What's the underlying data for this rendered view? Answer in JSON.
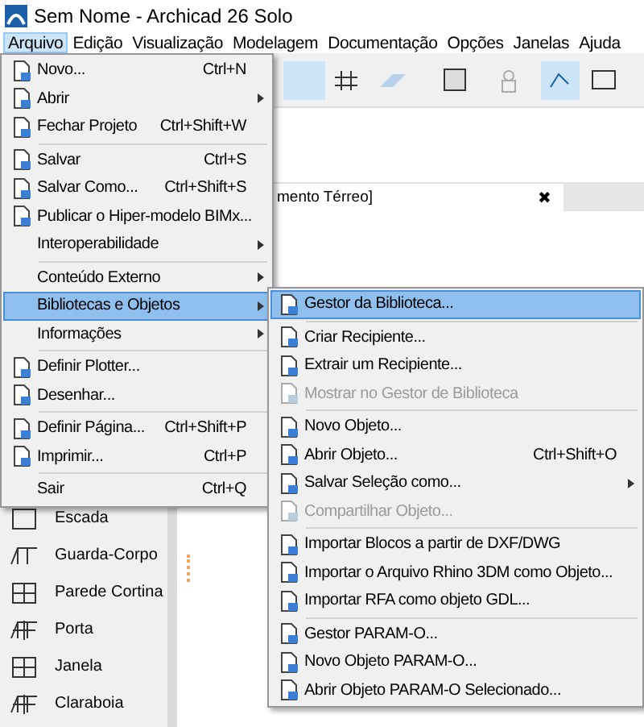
{
  "window": {
    "title": "Sem Nome - Archicad 26 Solo"
  },
  "menubar": [
    {
      "label": "Arquivo",
      "selected": true
    },
    {
      "label": "Edição",
      "selected": false
    },
    {
      "label": "Visualização",
      "selected": false
    },
    {
      "label": "Modelagem",
      "selected": false
    },
    {
      "label": "Documentação",
      "selected": false
    },
    {
      "label": "Opções",
      "selected": false
    },
    {
      "label": "Janelas",
      "selected": false
    },
    {
      "label": "Ajuda",
      "selected": false
    }
  ],
  "menu": {
    "items": [
      {
        "kind": "item",
        "label": "Novo...",
        "shortcut": "Ctrl+N",
        "icon": true,
        "submenu": false,
        "selected": false,
        "disabled": false
      },
      {
        "kind": "item",
        "label": "Abrir",
        "icon": true,
        "submenu": true,
        "selected": false,
        "disabled": false
      },
      {
        "kind": "item",
        "label": "Fechar Projeto",
        "shortcut": "Ctrl+Shift+W",
        "icon": true,
        "submenu": false,
        "selected": false,
        "disabled": false
      },
      {
        "kind": "separator"
      },
      {
        "kind": "item",
        "label": "Salvar",
        "shortcut": "Ctrl+S",
        "icon": true,
        "submenu": false,
        "selected": false,
        "disabled": false
      },
      {
        "kind": "item",
        "label": "Salvar Como...",
        "shortcut": "Ctrl+Shift+S",
        "icon": true,
        "submenu": false,
        "selected": false,
        "disabled": false
      },
      {
        "kind": "item",
        "label": "Publicar o Hiper-modelo BIMx...",
        "icon": true,
        "submenu": false,
        "selected": false,
        "disabled": false
      },
      {
        "kind": "item",
        "label": "Interoperabilidade",
        "icon": false,
        "submenu": true,
        "selected": false,
        "disabled": false
      },
      {
        "kind": "separator"
      },
      {
        "kind": "item",
        "label": "Conteúdo Externo",
        "icon": false,
        "submenu": true,
        "selected": false,
        "disabled": false
      },
      {
        "kind": "item",
        "label": "Bibliotecas e Objetos",
        "icon": false,
        "submenu": true,
        "selected": true,
        "disabled": false
      },
      {
        "kind": "item",
        "label": "Informações",
        "icon": false,
        "submenu": true,
        "selected": false,
        "disabled": false
      },
      {
        "kind": "separator"
      },
      {
        "kind": "item",
        "label": "Definir Plotter...",
        "icon": true,
        "submenu": false,
        "selected": false,
        "disabled": false
      },
      {
        "kind": "item",
        "label": "Desenhar...",
        "icon": true,
        "submenu": false,
        "selected": false,
        "disabled": false
      },
      {
        "kind": "separator"
      },
      {
        "kind": "item",
        "label": "Definir Página...",
        "shortcut": "Ctrl+Shift+P",
        "icon": true,
        "submenu": false,
        "selected": false,
        "disabled": false
      },
      {
        "kind": "item",
        "label": "Imprimir...",
        "shortcut": "Ctrl+P",
        "icon": true,
        "submenu": false,
        "selected": false,
        "disabled": false
      },
      {
        "kind": "separator"
      },
      {
        "kind": "item",
        "label": "Sair",
        "shortcut": "Ctrl+Q",
        "icon": false,
        "submenu": false,
        "selected": false,
        "disabled": false
      }
    ]
  },
  "submenu": {
    "items": [
      {
        "kind": "item",
        "label": "Gestor da Biblioteca...",
        "icon": true,
        "submenu": false,
        "selected": true,
        "disabled": false
      },
      {
        "kind": "separator"
      },
      {
        "kind": "item",
        "label": "Criar Recipiente...",
        "icon": true,
        "submenu": false,
        "selected": false,
        "disabled": false
      },
      {
        "kind": "item",
        "label": "Extrair um Recipiente...",
        "icon": true,
        "submenu": false,
        "selected": false,
        "disabled": false
      },
      {
        "kind": "item",
        "label": "Mostrar no Gestor de Biblioteca",
        "icon": true,
        "submenu": false,
        "selected": false,
        "disabled": true
      },
      {
        "kind": "separator"
      },
      {
        "kind": "item",
        "label": "Novo Objeto...",
        "icon": true,
        "submenu": false,
        "selected": false,
        "disabled": false
      },
      {
        "kind": "item",
        "label": "Abrir Objeto...",
        "shortcut": "Ctrl+Shift+O",
        "icon": true,
        "submenu": false,
        "selected": false,
        "disabled": false
      },
      {
        "kind": "item",
        "label": "Salvar Seleção como...",
        "icon": true,
        "submenu": true,
        "selected": false,
        "disabled": false
      },
      {
        "kind": "item",
        "label": "Compartilhar Objeto...",
        "icon": true,
        "submenu": false,
        "selected": false,
        "disabled": true
      },
      {
        "kind": "separator"
      },
      {
        "kind": "item",
        "label": "Importar Blocos a partir de DXF/DWG",
        "icon": true,
        "submenu": false,
        "selected": false,
        "disabled": false
      },
      {
        "kind": "item",
        "label": "Importar o Arquivo Rhino 3DM como Objeto...",
        "icon": true,
        "submenu": false,
        "selected": false,
        "disabled": false
      },
      {
        "kind": "item",
        "label": "Importar RFA como objeto GDL...",
        "icon": true,
        "submenu": false,
        "selected": false,
        "disabled": false
      },
      {
        "kind": "separator"
      },
      {
        "kind": "item",
        "label": "Gestor PARAM-O...",
        "icon": true,
        "submenu": false,
        "selected": false,
        "disabled": false
      },
      {
        "kind": "item",
        "label": "Novo Objeto PARAM-O...",
        "icon": true,
        "submenu": false,
        "selected": false,
        "disabled": false
      },
      {
        "kind": "item",
        "label": "Abrir Objeto PARAM-O Selecionado...",
        "icon": true,
        "submenu": false,
        "selected": false,
        "disabled": false
      }
    ]
  },
  "view_tab": {
    "label": "mento Térreo]",
    "close": "✖"
  },
  "toolbox": [
    {
      "label": "Escada"
    },
    {
      "label": "Guarda-Corpo"
    },
    {
      "label": "Parede Cortina"
    },
    {
      "label": "Porta"
    },
    {
      "label": "Janela"
    },
    {
      "label": "Claraboia"
    }
  ]
}
